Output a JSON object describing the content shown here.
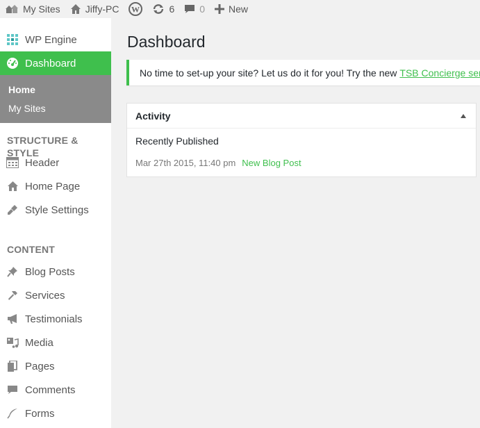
{
  "admin_bar": {
    "my_sites": "My Sites",
    "site_name": "Jiffy-PC",
    "updates_count": "6",
    "comments_count": "0",
    "new_label": "New"
  },
  "sidebar": {
    "wp_engine": "WP Engine",
    "dashboard": "Dashboard",
    "submenu": [
      "Home",
      "My Sites"
    ],
    "structure_heading": "STRUCTURE & STYLE",
    "structure_items": [
      "Header",
      "Home Page",
      "Style Settings"
    ],
    "content_heading": "CONTENT",
    "content_items": [
      "Blog Posts",
      "Services",
      "Testimonials",
      "Media",
      "Pages",
      "Comments",
      "Forms"
    ]
  },
  "main": {
    "title": "Dashboard",
    "notice_text": "No time to set-up your site? Let us do it for you! Try the new",
    "notice_link": "TSB Concierge service"
  },
  "activity": {
    "title": "Activity",
    "recently_published": "Recently Published",
    "post_date": "Mar 27th 2015, 11:40 pm",
    "post_title": "New Blog Post"
  },
  "colors": {
    "accent": "#3fbf4d",
    "submenu_bg": "#8a8a8a",
    "page_bg": "#f1f1f1"
  }
}
